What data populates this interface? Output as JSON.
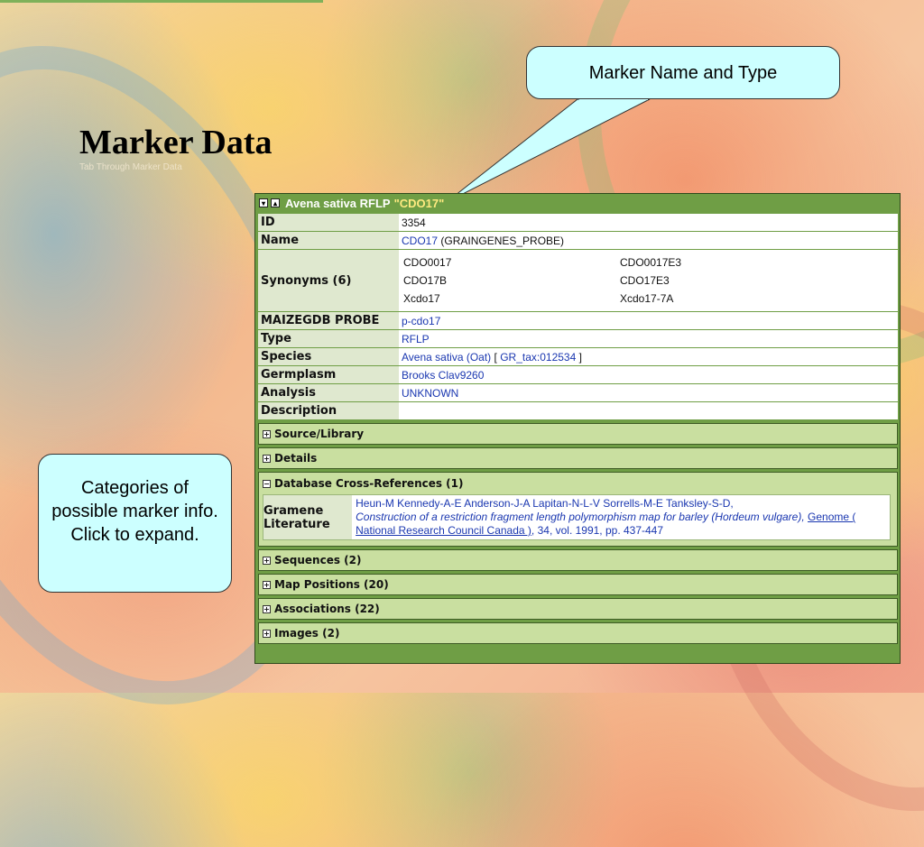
{
  "slide": {
    "title": "Marker Data",
    "subtitle": "Tab Through Marker Data"
  },
  "callouts": {
    "top": "Marker Name and Type",
    "left": "Categories of possible marker info. Click to expand."
  },
  "panel": {
    "header_title": "Avena sativa RFLP \"CDO17\"",
    "header_species": "Avena sativa RFLP",
    "header_name": "\"CDO17\"",
    "rows": {
      "id_label": "ID",
      "id_value": "3354",
      "name_label": "Name",
      "name_link": "CDO17",
      "name_suffix": "(GRAINGENES_PROBE)",
      "synonyms_label": "Synonyms (6)",
      "synonyms": [
        "CDO0017",
        "CDO0017E3",
        "CDO17B",
        "CDO17E3",
        "Xcdo17",
        "Xcdo17-7A"
      ],
      "maizegdb_label": "MAIZEGDB PROBE",
      "maizegdb_value": "p-cdo17",
      "type_label": "Type",
      "type_value": "RFLP",
      "species_label": "Species",
      "species_value": "Avena sativa (Oat)",
      "species_bracket_open": "[",
      "species_tax": "GR_tax:012534",
      "species_bracket_close": "]",
      "germplasm_label": "Germplasm",
      "germplasm_value": "Brooks Clav9260",
      "analysis_label": "Analysis",
      "analysis_value": "UNKNOWN",
      "description_label": "Description",
      "description_value": ""
    },
    "sections": {
      "source": "Source/Library",
      "details": "Details",
      "xref": "Database Cross-References (1)",
      "sequences": "Sequences (2)",
      "map_positions": "Map Positions (20)",
      "associations": "Associations (22)",
      "images": "Images (2)"
    },
    "xref_entry": {
      "label": "Gramene Literature",
      "authors": "Heun-M Kennedy-A-E Anderson-J-A Lapitan-N-L-V Sorrells-M-E Tanksley-S-D,",
      "title": "Construction of a restriction fragment length polymorphism map for barley (Hordeum vulgare),",
      "journal": "Genome ( National Research Council Canada )",
      "citation": ", 34, vol. 1991, pp. 437-447"
    },
    "icons": {
      "collapse": "collapse-icon",
      "expand": "expand-icon"
    }
  }
}
